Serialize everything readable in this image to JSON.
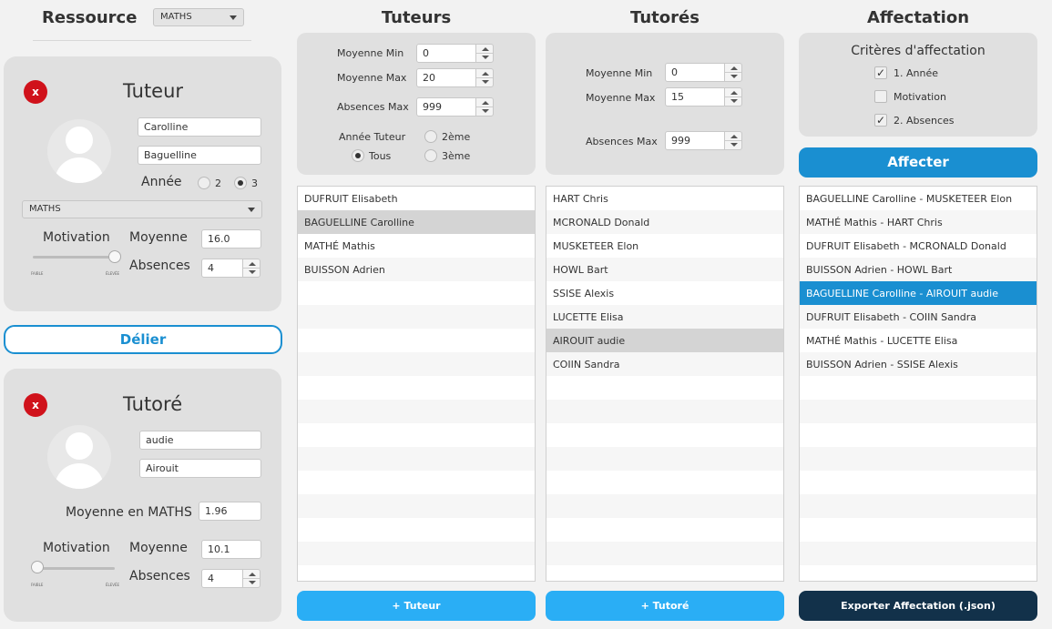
{
  "header": {
    "resource_label": "Ressource",
    "resource_value": "MATHS",
    "tuteurs_title": "Tuteurs",
    "tutores_title": "Tutorés",
    "affectation_title": "Affectation"
  },
  "tuteur_card": {
    "title": "Tuteur",
    "close": "x",
    "firstname": "Carolline",
    "lastname": "Baguelline",
    "annee_label": "Année",
    "annee_options": [
      "2",
      "3"
    ],
    "annee_selected": "3",
    "matiere": "MATHS",
    "motivation_label": "Motivation",
    "moyenne_label": "Moyenne",
    "moyenne_value": "16.0",
    "absences_label": "Absences",
    "absences_value": "4",
    "slider_min": "FAIBLE",
    "slider_max": "ÉLEVÉE",
    "motivation_level": 1.0
  },
  "delier_button": "Délier",
  "tutore_card": {
    "title": "Tutoré",
    "close": "x",
    "firstname": "audie",
    "lastname": "Airouit",
    "moyenne_matiere_label": "Moyenne en MATHS",
    "moyenne_matiere_value": "1.96",
    "motivation_label": "Motivation",
    "moyenne_label": "Moyenne",
    "moyenne_value": "10.1",
    "absences_label": "Absences",
    "absences_value": "4",
    "slider_min": "FAIBLE",
    "slider_max": "ÉLEVÉE",
    "motivation_level": 0.0
  },
  "tuteurs_filters": {
    "moyenne_min_label": "Moyenne Min",
    "moyenne_min_value": "0",
    "moyenne_max_label": "Moyenne Max",
    "moyenne_max_value": "20",
    "absences_max_label": "Absences Max",
    "absences_max_value": "999",
    "annee_label": "Année Tuteur",
    "annee_options": [
      "2ème",
      "Tous",
      "3ème"
    ],
    "annee_selected": "Tous"
  },
  "tutores_filters": {
    "moyenne_min_label": "Moyenne Min",
    "moyenne_min_value": "0",
    "moyenne_max_label": "Moyenne Max",
    "moyenne_max_value": "15",
    "absences_max_label": "Absences Max",
    "absences_max_value": "999"
  },
  "tuteurs_list": [
    "DUFRUIT Elisabeth",
    "BAGUELLINE Carolline",
    "MATHÉ Mathis",
    "BUISSON Adrien"
  ],
  "tuteurs_selected": 1,
  "tutores_list": [
    "HART Chris",
    "MCRONALD Donald",
    "MUSKETEER Elon",
    "HOWL Bart",
    "SSISE Alexis",
    "LUCETTE Elisa",
    "AIROUIT audie",
    "COIIN Sandra"
  ],
  "tutores_selected": 6,
  "criteria": {
    "title": "Critères d'affectation",
    "items": [
      {
        "label": "1. Année",
        "checked": true
      },
      {
        "label": "Motivation",
        "checked": false
      },
      {
        "label": "2. Absences",
        "checked": true
      }
    ]
  },
  "affecter_button": "Affecter",
  "affectations": [
    "BAGUELLINE Carolline - MUSKETEER Elon",
    "MATHÉ Mathis - HART Chris",
    "DUFRUIT Elisabeth - MCRONALD Donald",
    "BUISSON Adrien - HOWL Bart",
    "BAGUELLINE Carolline - AIROUIT audie",
    "DUFRUIT Elisabeth - COIIN Sandra",
    "MATHÉ Mathis - LUCETTE Elisa",
    "BUISSON Adrien - SSISE Alexis"
  ],
  "affectations_selected": 4,
  "add_tuteur_button": "+ Tuteur",
  "add_tutore_button": "+ Tutoré",
  "export_button": "Exporter Affectation (.json)",
  "colors": {
    "accent_blue": "#1a8fd1",
    "button_blue": "#2aaef5",
    "close_red": "#d0121b",
    "export_dark": "#12314a"
  }
}
